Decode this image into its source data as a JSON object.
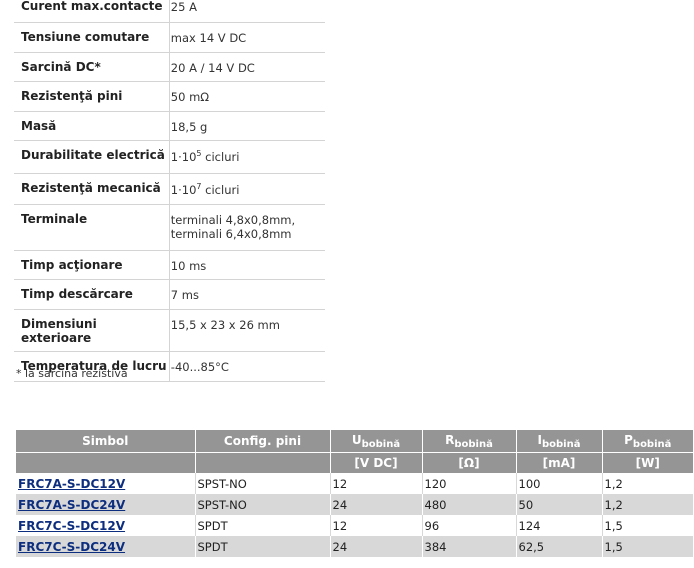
{
  "specs": [
    {
      "label": "Curent max.contacte",
      "value": "25 A"
    },
    {
      "label": "Tensiune comutare",
      "value": "max 14 V DC"
    },
    {
      "label": "Sarcină DC*",
      "value": "20 A / 14 V DC"
    },
    {
      "label": "Rezistenţă pini",
      "value": "50 mΩ"
    },
    {
      "label": "Masă",
      "value": "18,5 g"
    },
    {
      "label": "Durabilitate electrică",
      "value_pre": "1·10",
      "value_sup": "5",
      "value_post": " cicluri"
    },
    {
      "label": "Rezistenţă mecanică",
      "value_pre": "1·10",
      "value_sup": "7",
      "value_post": " cicluri"
    },
    {
      "label": "Terminale",
      "value": "terminali 4,8x0,8mm,",
      "value2": "terminali 6,4x0,8mm"
    },
    {
      "label": "Timp acţionare",
      "value": "10 ms"
    },
    {
      "label": "Timp descărcare",
      "value": "7 ms"
    },
    {
      "label": "Dimensiuni exterioare",
      "value": "15,5 x 23 x 26 mm"
    },
    {
      "label": "Temperatura de lucru",
      "value": "-40...85°C"
    }
  ],
  "note": "* la sarcina rezistivă",
  "models": {
    "headers": [
      {
        "main": "Simbol"
      },
      {
        "main": "Config. pini"
      },
      {
        "main": "U",
        "sub": "bobină"
      },
      {
        "main": "R",
        "sub": "bobină"
      },
      {
        "main": "I",
        "sub": "bobină"
      },
      {
        "main": "P",
        "sub": "bobină"
      }
    ],
    "units": [
      "",
      "",
      "[V DC]",
      "[Ω]",
      "[mA]",
      "[W]"
    ],
    "rows": [
      {
        "symbol": "FRC7A-S-DC12V",
        "config": "SPST-NO",
        "u": "12",
        "r": "120",
        "i": "100",
        "p": "1,2"
      },
      {
        "symbol": "FRC7A-S-DC24V",
        "config": "SPST-NO",
        "u": "24",
        "r": "480",
        "i": "50",
        "p": "1,2"
      },
      {
        "symbol": "FRC7C-S-DC12V",
        "config": "SPDT",
        "u": "12",
        "r": "96",
        "i": "124",
        "p": "1,5"
      },
      {
        "symbol": "FRC7C-S-DC24V",
        "config": "SPDT",
        "u": "24",
        "r": "384",
        "i": "62,5",
        "p": "1,5"
      }
    ]
  }
}
